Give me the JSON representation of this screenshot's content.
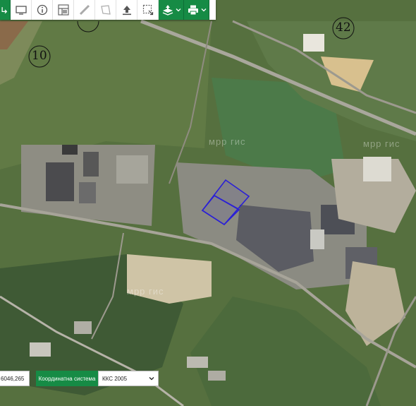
{
  "map": {
    "cadastre_labels": [
      "10",
      "42"
    ],
    "watermarks": [
      "мрр гис",
      "мрр гис",
      "мрр гис"
    ],
    "parcel_color": "#2a1fd6"
  },
  "toolbar": {
    "buttons": [
      {
        "icon": "layers-arrows-icon",
        "style": "accent"
      },
      {
        "icon": "screen-icon"
      },
      {
        "icon": "info-icon"
      },
      {
        "icon": "parcel-grid-icon"
      },
      {
        "icon": "ruler-icon"
      },
      {
        "icon": "area-measure-icon"
      },
      {
        "icon": "upload-icon"
      },
      {
        "icon": "select-area-icon"
      },
      {
        "icon": "layer-switcher-icon",
        "style": "accent",
        "dropdown": true
      },
      {
        "icon": "print-icon",
        "style": "accent",
        "dropdown": true
      }
    ],
    "accent_color": "#168b45"
  },
  "status": {
    "coordinate_value": "6046,265",
    "coordinate_system_label": "Координатна система",
    "coordinate_system_value": "ККС 2005"
  }
}
